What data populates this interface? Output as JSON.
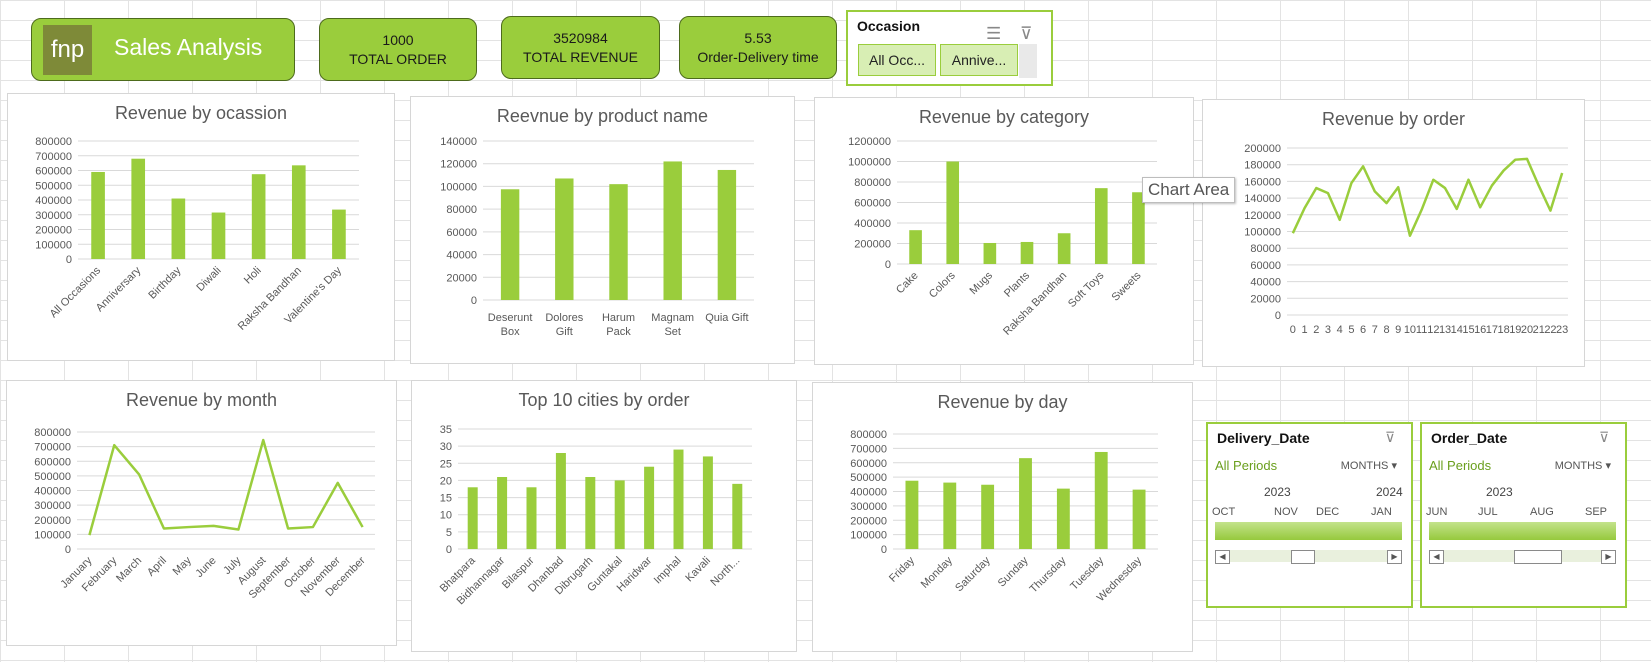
{
  "brand": {
    "logo_text": "fnp",
    "title": "Sales Analysis"
  },
  "kpis": [
    {
      "value": "1000",
      "label": "TOTAL ORDER"
    },
    {
      "value": "3520984",
      "label": "TOTAL REVENUE"
    },
    {
      "value": "5.53",
      "label": "Order-Delivery time"
    }
  ],
  "occasion_slicer": {
    "title": "Occasion",
    "items": [
      "All Occ...",
      "Annive..."
    ],
    "icons": [
      "multi-select-icon",
      "clear-filter-icon"
    ]
  },
  "tooltip": "Chart Area",
  "colors": {
    "accent": "#9acd3c",
    "border": "#4d6b1c",
    "gridline": "#d9d9d9",
    "text": "#595959"
  },
  "charts": [
    {
      "id": "occasion",
      "type": "bar",
      "title": "Revenue by ocassion",
      "categories": [
        "All Occasions",
        "Anniversary",
        "Birthday",
        "Diwali",
        "Holi",
        "Raksha Bandhan",
        "Valentine's Day"
      ],
      "values": [
        590000,
        680000,
        410000,
        315000,
        575000,
        635000,
        335000
      ],
      "yticks": [
        0,
        100000,
        200000,
        300000,
        400000,
        500000,
        600000,
        700000,
        800000
      ],
      "ylim": [
        0,
        800000
      ],
      "rotate": true
    },
    {
      "id": "product",
      "type": "bar",
      "title": "Reevnue by product name",
      "categories": [
        "Deserunt Box",
        "Dolores Gift",
        "Harum Pack",
        "Magnam Set",
        "Quia Gift"
      ],
      "values": [
        97500,
        107000,
        102000,
        122000,
        114500
      ],
      "yticks": [
        0,
        20000,
        40000,
        60000,
        80000,
        100000,
        120000,
        140000
      ],
      "ylim": [
        0,
        140000
      ],
      "rotate": false
    },
    {
      "id": "category",
      "type": "bar",
      "title": "Revenue by category",
      "categories": [
        "Cake",
        "Colors",
        "Mugs",
        "Plants",
        "Raksha Bandhan",
        "Soft Toys",
        "Sweets"
      ],
      "values": [
        330000,
        1000000,
        205000,
        215000,
        300000,
        740000,
        700000
      ],
      "yticks": [
        0,
        200000,
        400000,
        600000,
        800000,
        1000000,
        1200000
      ],
      "ylim": [
        0,
        1200000
      ],
      "rotate": true
    },
    {
      "id": "hour",
      "type": "line",
      "title": "Revenue by order",
      "categories": [
        "0",
        "1",
        "2",
        "3",
        "4",
        "5",
        "6",
        "7",
        "8",
        "9",
        "10",
        "11",
        "12",
        "13",
        "14",
        "15",
        "16",
        "17",
        "18",
        "19",
        "20",
        "21",
        "22",
        "23"
      ],
      "values": [
        98000,
        128000,
        152000,
        146000,
        114000,
        158000,
        178000,
        148000,
        134000,
        153000,
        95000,
        126000,
        162000,
        152000,
        127000,
        162000,
        129000,
        155000,
        173000,
        186000,
        187000,
        155000,
        125000,
        170000
      ],
      "yticks": [
        0,
        20000,
        40000,
        60000,
        80000,
        100000,
        120000,
        140000,
        160000,
        180000,
        200000
      ],
      "ylim": [
        0,
        200000
      ],
      "rotate": false
    },
    {
      "id": "month",
      "type": "line",
      "title": "Revenue by month",
      "categories": [
        "January",
        "February",
        "March",
        "April",
        "May",
        "June",
        "July",
        "August",
        "September",
        "October",
        "November",
        "December"
      ],
      "values": [
        95000,
        710000,
        510000,
        140000,
        150000,
        158000,
        133000,
        745000,
        140000,
        150000,
        452000,
        150000
      ],
      "yticks": [
        0,
        100000,
        200000,
        300000,
        400000,
        500000,
        600000,
        700000,
        800000
      ],
      "ylim": [
        0,
        800000
      ],
      "rotate": true
    },
    {
      "id": "cities",
      "type": "bar",
      "title": "Top 10 cities by order",
      "categories": [
        "Bhatpara",
        "Bidhannagar",
        "Bilaspur",
        "Dhanbad",
        "Dibrugarh",
        "Guntakal",
        "Haridwar",
        "Imphal",
        "Kavali",
        "North..."
      ],
      "values": [
        18,
        21,
        18,
        28,
        21,
        20,
        24,
        29,
        27,
        19
      ],
      "yticks": [
        0,
        5,
        10,
        15,
        20,
        25,
        30,
        35
      ],
      "ylim": [
        0,
        35
      ],
      "rotate": true
    },
    {
      "id": "day",
      "type": "bar",
      "title": "Revenue by day",
      "categories": [
        "Friday",
        "Monday",
        "Saturday",
        "Sunday",
        "Thursday",
        "Tuesday",
        "Wednesday"
      ],
      "values": [
        475000,
        462000,
        447000,
        632000,
        420000,
        675000,
        413000
      ],
      "yticks": [
        0,
        100000,
        200000,
        300000,
        400000,
        500000,
        600000,
        700000,
        800000
      ],
      "ylim": [
        0,
        800000
      ],
      "rotate": true
    }
  ],
  "timelines": [
    {
      "title": "Delivery_Date",
      "all_periods": "All Periods",
      "level": "MONTHS",
      "years": [
        "2023",
        "2024"
      ],
      "months": [
        "OCT",
        "NOV",
        "DEC",
        "JAN"
      ]
    },
    {
      "title": "Order_Date",
      "all_periods": "All Periods",
      "level": "MONTHS",
      "years": [
        "2023"
      ],
      "months": [
        "JUN",
        "JUL",
        "AUG",
        "SEP"
      ]
    }
  ]
}
